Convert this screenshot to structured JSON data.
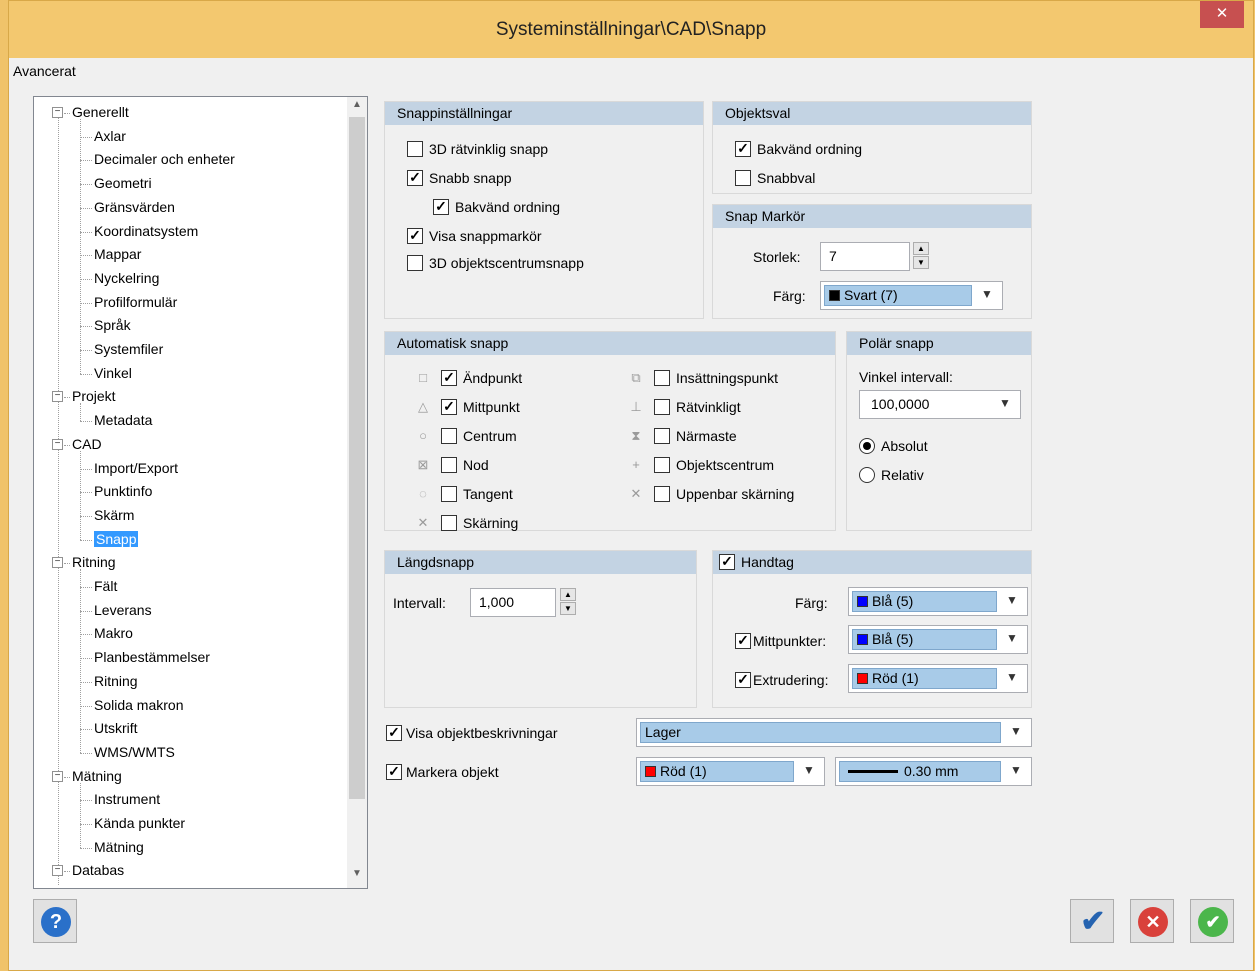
{
  "window": {
    "title": "Systeminställningar\\CAD\\Snapp",
    "close_glyph": "✕"
  },
  "menu": {
    "item": "Avancerat"
  },
  "tree": {
    "nodes": [
      {
        "label": "Generellt",
        "level": 0,
        "expanded": true
      },
      {
        "label": "Axlar",
        "level": 1
      },
      {
        "label": "Decimaler och enheter",
        "level": 1
      },
      {
        "label": "Geometri",
        "level": 1
      },
      {
        "label": "Gränsvärden",
        "level": 1
      },
      {
        "label": "Koordinatsystem",
        "level": 1
      },
      {
        "label": "Mappar",
        "level": 1
      },
      {
        "label": "Nyckelring",
        "level": 1
      },
      {
        "label": "Profilformulär",
        "level": 1
      },
      {
        "label": "Språk",
        "level": 1
      },
      {
        "label": "Systemfiler",
        "level": 1
      },
      {
        "label": "Vinkel",
        "level": 1
      },
      {
        "label": "Projekt",
        "level": 0,
        "expanded": true
      },
      {
        "label": "Metadata",
        "level": 1
      },
      {
        "label": "CAD",
        "level": 0,
        "expanded": true
      },
      {
        "label": "Import/Export",
        "level": 1
      },
      {
        "label": "Punktinfo",
        "level": 1
      },
      {
        "label": "Skärm",
        "level": 1
      },
      {
        "label": "Snapp",
        "level": 1,
        "selected": true
      },
      {
        "label": "Ritning",
        "level": 0,
        "expanded": true
      },
      {
        "label": "Fält",
        "level": 1
      },
      {
        "label": "Leverans",
        "level": 1
      },
      {
        "label": "Makro",
        "level": 1
      },
      {
        "label": "Planbestämmelser",
        "level": 1
      },
      {
        "label": "Ritning",
        "level": 1
      },
      {
        "label": "Solida makron",
        "level": 1
      },
      {
        "label": "Utskrift",
        "level": 1
      },
      {
        "label": "WMS/WMTS",
        "level": 1
      },
      {
        "label": "Mätning",
        "level": 0,
        "expanded": true
      },
      {
        "label": "Instrument",
        "level": 1
      },
      {
        "label": "Kända punkter",
        "level": 1
      },
      {
        "label": "Mätning",
        "level": 1
      },
      {
        "label": "Databas",
        "level": 0,
        "expanded": true
      }
    ]
  },
  "snappinstallningar": {
    "header": "Snappinställningar",
    "items": [
      {
        "label": "3D rätvinklig snapp",
        "checked": false
      },
      {
        "label": "Snabb snapp",
        "checked": true
      },
      {
        "label": "Bakvänd ordning",
        "checked": true
      },
      {
        "label": "Visa snappmarkör",
        "checked": true
      },
      {
        "label": "3D objektscentrumsnapp",
        "checked": false
      }
    ]
  },
  "objektsval": {
    "header": "Objektsval",
    "items": [
      {
        "label": "Bakvänd ordning",
        "checked": true
      },
      {
        "label": "Snabbval",
        "checked": false
      }
    ]
  },
  "snap_markor": {
    "header": "Snap Markör",
    "size_label": "Storlek:",
    "size_value": "7",
    "color_label": "Färg:",
    "color_value": "Svart (7)",
    "color_hex": "#000000"
  },
  "automatisk_snapp": {
    "header": "Automatisk snapp",
    "left": [
      {
        "label": "Ändpunkt",
        "checked": true,
        "icon": "square-snap-icon"
      },
      {
        "label": "Mittpunkt",
        "checked": true,
        "icon": "triangle-snap-icon"
      },
      {
        "label": "Centrum",
        "checked": false,
        "icon": "circle-snap-icon"
      },
      {
        "label": "Nod",
        "checked": false,
        "icon": "node-snap-icon"
      },
      {
        "label": "Tangent",
        "checked": false,
        "icon": "tangent-snap-icon"
      },
      {
        "label": "Skärning",
        "checked": false,
        "icon": "intersection-snap-icon"
      }
    ],
    "right": [
      {
        "label": "Insättningspunkt",
        "checked": false,
        "icon": "insertion-snap-icon"
      },
      {
        "label": "Rätvinkligt",
        "checked": false,
        "icon": "perpendicular-snap-icon"
      },
      {
        "label": "Närmaste",
        "checked": false,
        "icon": "nearest-snap-icon"
      },
      {
        "label": "Objektscentrum",
        "checked": false,
        "icon": "object-center-snap-icon"
      },
      {
        "label": "Uppenbar skärning",
        "checked": false,
        "icon": "apparent-intersection-snap-icon"
      }
    ]
  },
  "polar_snapp": {
    "header": "Polär snapp",
    "interval_label": "Vinkel intervall:",
    "interval_value": "100,0000",
    "absolut_label": "Absolut",
    "relativ_label": "Relativ",
    "selected": "Absolut"
  },
  "langdsnapp": {
    "header": "Längdsnapp",
    "interval_label": "Intervall:",
    "interval_value": "1,000"
  },
  "handtag": {
    "header": "Handtag",
    "checked": true,
    "color_label": "Färg:",
    "color_value": "Blå (5)",
    "color_hex": "#0000ff",
    "mittpunkter_label": "Mittpunkter:",
    "mittpunkter_checked": true,
    "mittpunkter_value": "Blå (5)",
    "extrudering_label": "Extrudering:",
    "extrudering_checked": true,
    "extrudering_value": "Röd (1)",
    "extrudering_hex": "#ff0000"
  },
  "visa_objektbeskrivningar": {
    "label": "Visa objektbeskrivningar",
    "checked": true,
    "value": "Lager"
  },
  "markera_objekt": {
    "label": "Markera objekt",
    "checked": true,
    "color_value": "Röd (1)",
    "color_hex": "#ff0000",
    "line_value": "0.30 mm"
  },
  "buttons": {
    "help": "?",
    "ok": "✔",
    "cancel": "✕",
    "apply": "✔"
  }
}
